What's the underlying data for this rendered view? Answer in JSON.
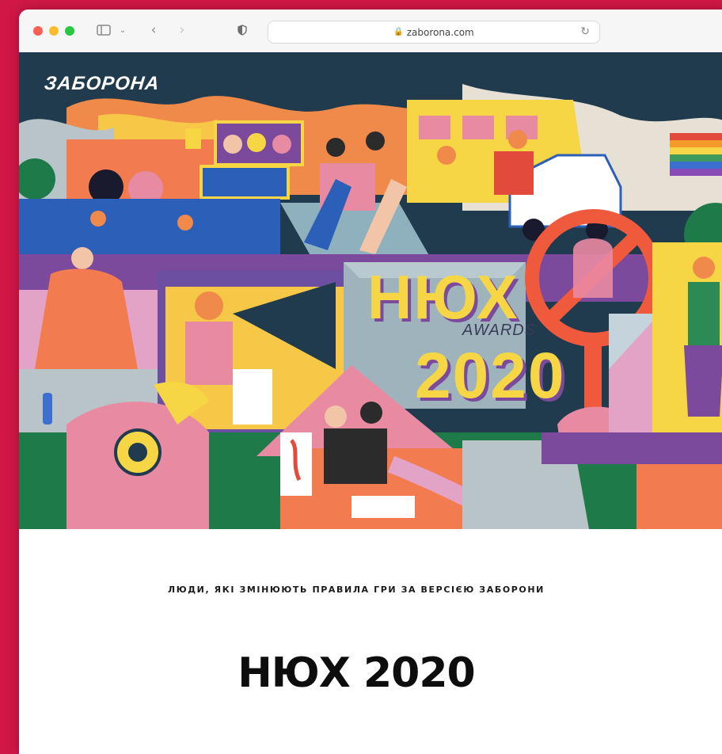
{
  "browser": {
    "address": "zaborona.com",
    "colors": {
      "close": "#ff5f57",
      "minimize": "#febc2e",
      "zoom": "#28c840"
    },
    "icons": [
      "sidebar-icon",
      "chevron-down-icon",
      "back-icon",
      "forward-icon",
      "shield-icon",
      "lock-icon",
      "reload-icon"
    ]
  },
  "hero": {
    "brand": "ЗАБОРОНА",
    "awards_title": "НЮХ",
    "awards_sub": "AWARDS",
    "awards_year": "2020"
  },
  "article": {
    "kicker": "ЛЮДИ, ЯКІ ЗМІНЮЮТЬ ПРАВИЛА ГРИ ЗА ВЕРСІЄЮ ЗАБОРОНИ",
    "title": "НЮХ 2020"
  },
  "page_bg": "#d01746"
}
